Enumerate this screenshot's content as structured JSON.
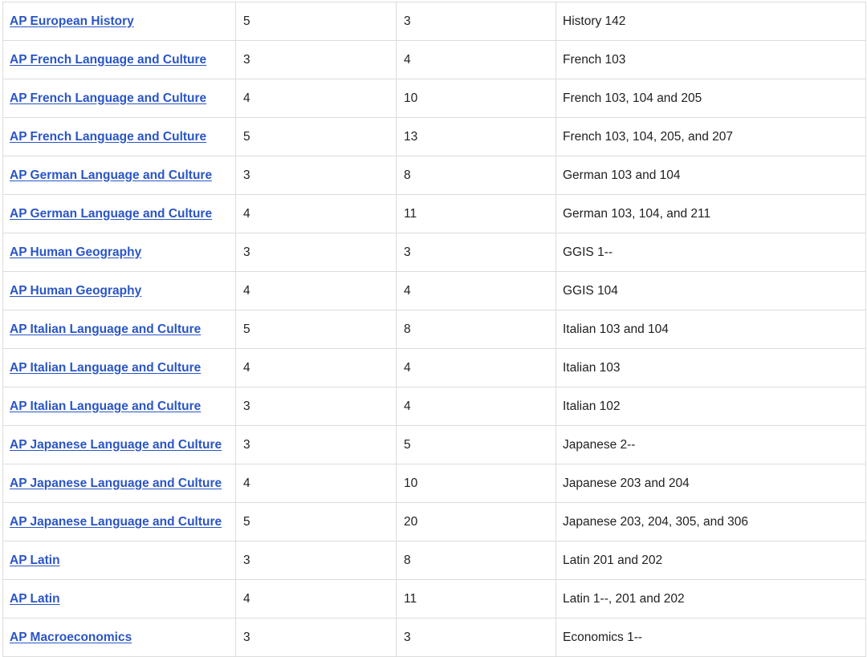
{
  "rows": [
    {
      "course": "AP European History",
      "score": "5",
      "credits": "3",
      "equivalent": "History 142"
    },
    {
      "course": "AP French Language and Culture",
      "score": "3",
      "credits": "4",
      "equivalent": "French 103"
    },
    {
      "course": "AP French Language and Culture",
      "score": "4",
      "credits": "10",
      "equivalent": "French 103, 104 and 205"
    },
    {
      "course": "AP French Language and Culture",
      "score": "5",
      "credits": "13",
      "equivalent": "French 103, 104, 205, and 207"
    },
    {
      "course": "AP German Language and Culture",
      "score": "3",
      "credits": "8",
      "equivalent": "German 103 and 104"
    },
    {
      "course": "AP German Language and Culture",
      "score": "4",
      "credits": "11",
      "equivalent": "German 103, 104, and 211"
    },
    {
      "course": "AP Human Geography",
      "score": "3",
      "credits": "3",
      "equivalent": "GGIS 1--"
    },
    {
      "course": "AP Human Geography",
      "score": "4",
      "credits": "4",
      "equivalent": "GGIS 104"
    },
    {
      "course": "AP Italian Language and Culture",
      "score": "5",
      "credits": "8",
      "equivalent": "Italian 103 and 104"
    },
    {
      "course": "AP Italian Language and Culture",
      "score": "4",
      "credits": "4",
      "equivalent": "Italian 103"
    },
    {
      "course": "AP Italian Language and Culture",
      "score": "3",
      "credits": "4",
      "equivalent": "Italian 102"
    },
    {
      "course": "AP Japanese Language and Culture",
      "score": "3",
      "credits": "5",
      "equivalent": "Japanese 2--"
    },
    {
      "course": "AP Japanese Language and Culture",
      "score": "4",
      "credits": "10",
      "equivalent": "Japanese 203 and 204"
    },
    {
      "course": "AP Japanese Language and Culture",
      "score": "5",
      "credits": "20",
      "equivalent": "Japanese 203, 204, 305, and 306"
    },
    {
      "course": "AP Latin",
      "score": "3",
      "credits": "8",
      "equivalent": "Latin 201 and 202"
    },
    {
      "course": "AP Latin",
      "score": "4",
      "credits": "11",
      "equivalent": "Latin 1--, 201 and 202"
    },
    {
      "course": "AP Macroeconomics",
      "score": "3",
      "credits": "3",
      "equivalent": "Economics 1--"
    }
  ]
}
